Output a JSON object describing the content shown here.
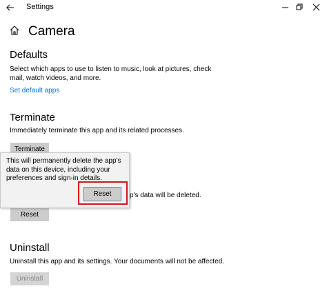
{
  "window": {
    "title": "Settings",
    "icons": {
      "back": "back-arrow-icon",
      "minimize": "minimize-icon",
      "maximize": "maximize-icon",
      "close": "close-icon"
    }
  },
  "page": {
    "title": "Camera",
    "icon": "home-icon"
  },
  "defaults": {
    "heading": "Defaults",
    "description": "Select which apps to use to listen to music, look at pictures, check mail, watch videos, and more.",
    "link": "Set default apps"
  },
  "terminate": {
    "heading": "Terminate",
    "description": "Immediately terminate this app and its related processes.",
    "button": "Terminate"
  },
  "reset": {
    "description_tail": "p's data will be deleted.",
    "button": "Reset"
  },
  "flyout": {
    "message": "This will permanently delete the app's data on this device, including your preferences and sign-in details.",
    "button": "Reset",
    "highlight_color": "#d4161c"
  },
  "uninstall": {
    "heading": "Uninstall",
    "description": "Uninstall this app and its settings. Your documents will not be affected.",
    "button": "Uninstall"
  },
  "colors": {
    "link": "#0a6ecf",
    "button": "#cccccc",
    "background": "#ffffff"
  }
}
